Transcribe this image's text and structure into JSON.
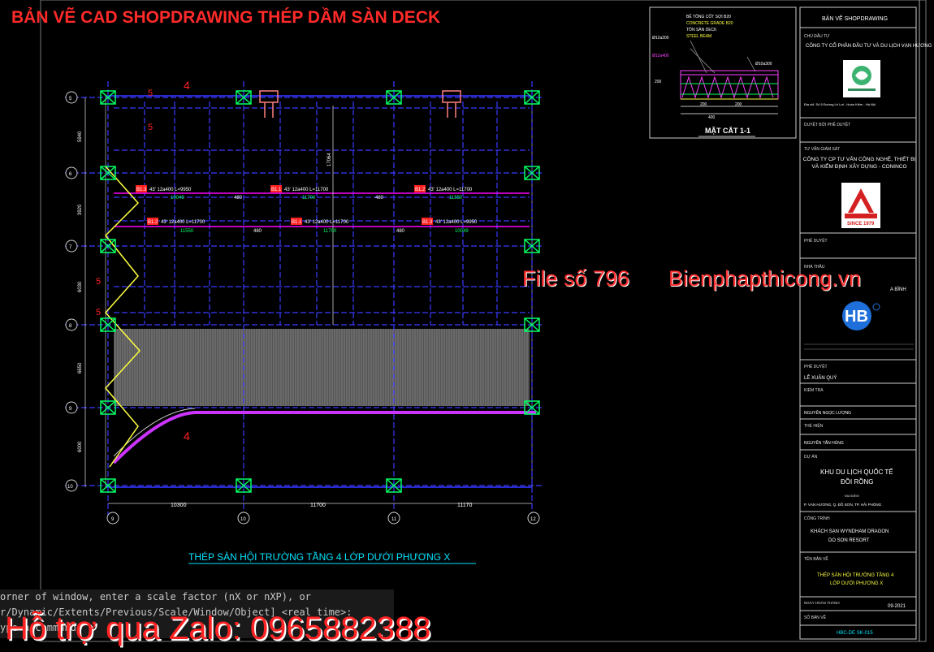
{
  "header": {
    "title": "BẢN VẼ CAD SHOPDRAWING THÉP DẦM SÀN DECK"
  },
  "watermark": {
    "file_no": "File số 796",
    "site": "Bienphapthicong.vn"
  },
  "plan": {
    "caption": "THÉP SÀN HỘI TRƯỜNG TẦNG 4 LỚP DƯỚI PHƯƠNG X",
    "grid_labels_left": [
      "5",
      "6",
      "7",
      "8",
      "9",
      "10"
    ],
    "grid_labels_bottom": [
      "9",
      "10",
      "11",
      "12"
    ],
    "bottom_dims": [
      "10300",
      "11700",
      "11170"
    ],
    "left_dims": [
      "5940",
      "3920",
      "6030",
      "6650",
      "6000"
    ],
    "vertical_dim": "17064",
    "rebar_row1": {
      "b13": "B1.3",
      "b13_spec": "43' 12a400 L=9950",
      "b13_len": "10049",
      "b11": "B1.1",
      "b11_spec": "43' 12a400 L=11700",
      "b11_len": "11700",
      "b12": "B1.2",
      "b12_spec": "43' 12a400 L=11700",
      "b12_len": "11550",
      "lap_a": "480",
      "lap_b": "480"
    },
    "rebar_row2": {
      "b12": "B1.2",
      "b12_spec": "43' 12a400 L=11700",
      "b12_len": "11550",
      "b11": "B1.1",
      "b11_spec": "43' 12a400 L=11700",
      "b11_len": "11700",
      "b13": "B1.3",
      "b13_spec": "43' 12a400 L=9950",
      "b13_len": "10049",
      "lap_a": "480",
      "lap_b": "480"
    },
    "red_markers": [
      "4",
      "5",
      "5",
      "5",
      "5",
      "4"
    ]
  },
  "section": {
    "title": "MẶT CẮT 1-1",
    "labels": [
      "BÊ TÔNG CỐT SỢI B20",
      "CONCRETE GRADE B20",
      "TÔN SÀN DECK",
      "STEEL BEAM",
      "Ø12a200",
      "Ø12a400",
      "Ø10a300"
    ],
    "dims": [
      "200",
      "400",
      "200",
      "200"
    ]
  },
  "titleblock": {
    "header": "BẢN VẼ SHOPDRAWING",
    "investor_label": "CHỦ ĐẦU TƯ",
    "investor_name": "CÔNG TY CỔ PHẦN ĐẦU TƯ VÀ DU LỊCH VẠN HƯƠNG",
    "investor_addr": "Địa chỉ: Số 5 Đường Lê Lợi - Hoàn Kiếm - Hà Nội",
    "approval_label": "DUYỆT BỞI PHÊ DUYỆT",
    "supervisor_label": "TƯ VẤN GIÁM SÁT",
    "supervisor_name": "CÔNG TY CP TƯ VẤN CÔNG NGHỆ, THIẾT BỊ VÀ KIỂM ĐỊNH XÂY DỰNG - CONINCO",
    "since": "SINCE 1979",
    "approve2": "PHÊ DUYỆT",
    "contractor_label": "NHÀ THẦU",
    "contractor_partial": "A BÌNH",
    "approve3": "PHÊ DUYỆT",
    "person1": "LÊ XUÂN QUÝ",
    "check_label": "KIỂM TRA",
    "person2": "NGUYỄN NGỌC LƯỢNG",
    "draw_label": "THỂ HIỆN",
    "person3": "NGUYỄN TẤN HÙNG",
    "project_label": "DỰ ÁN",
    "project_name_1": "KHU DU LỊCH QUỐC TẾ",
    "project_name_2": "ĐỒI RỒNG",
    "location_label": "ĐỊA ĐIỂM",
    "location": "P. VẠN HƯƠNG, Q. ĐỒ SƠN, TP. HẢI PHÒNG",
    "work_label": "CÔNG TRÌNH",
    "work_name_1": "KHÁCH SẠN WYNDHAM DRAGON",
    "work_name_2": "DO SON RESORT",
    "drawing_label": "TÊN BẢN VẼ",
    "drawing_name_1": "THÉP SÀN HỘI TRƯỜNG TẦNG 4",
    "drawing_name_2": "LỚP DƯỚI PHƯƠNG X",
    "date_label": "NGÀY HOÀN THÀNH",
    "date": "09-2021",
    "sheet_label": "SỐ BẢN VẼ",
    "sheet_no": "HBC-DE SK-015"
  },
  "command": {
    "line1": "orner of window, enter a scale factor (nX or nXP), or",
    "line2": "r/Dynamic/Extents/Previous/Scale/Window/Object] <real time>:",
    "line3": "ype a command"
  },
  "support": {
    "text": "Hỗ trợ qua Zalo: 0965882388"
  },
  "colors": {
    "grid_blue": "#3a3aff",
    "grid_green": "#00ff66",
    "magenta": "#ff00ff",
    "red_text": "#ff2020",
    "cyan": "#00e5ff",
    "yellow": "#ffff40"
  }
}
